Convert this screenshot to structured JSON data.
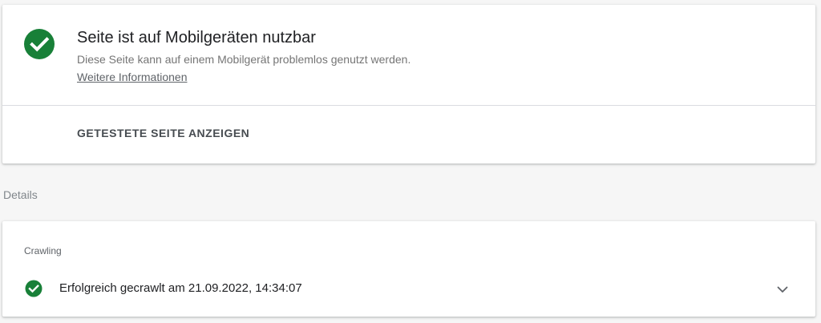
{
  "result": {
    "title": "Seite ist auf Mobilgeräten nutzbar",
    "description": "Diese Seite kann auf einem Mobilgerät problemlos genutzt werden.",
    "more_info_link": "Weitere Informationen",
    "status_icon": "check-circle-icon",
    "view_tested_page_button": "GETESTETE SEITE ANZEIGEN"
  },
  "details": {
    "heading": "Details",
    "crawling": {
      "label": "Crawling",
      "status_icon": "check-circle-icon",
      "status_text": "Erfolgreich gecrawlt am 21.09.2022, 14:34:07",
      "expand_icon": "chevron-down-icon"
    }
  },
  "colors": {
    "success_green": "#188038",
    "page_background": "#f6f6f6",
    "card_background": "#ffffff"
  }
}
